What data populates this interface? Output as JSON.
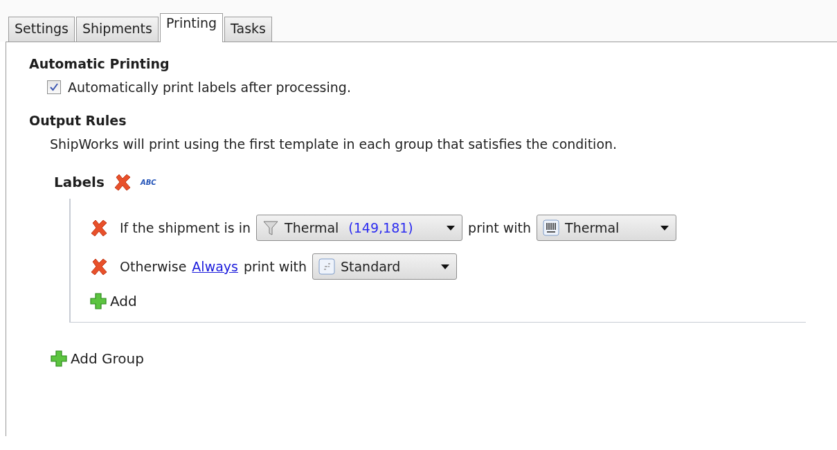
{
  "tabs": [
    {
      "label": "Settings",
      "selected": false
    },
    {
      "label": "Shipments",
      "selected": false
    },
    {
      "label": "Printing",
      "selected": true
    },
    {
      "label": "Tasks",
      "selected": false
    }
  ],
  "automatic_printing": {
    "heading": "Automatic Printing",
    "checkbox": {
      "label": "Automatically print labels after processing.",
      "checked": true
    }
  },
  "output_rules": {
    "heading": "Output Rules",
    "description": "ShipWorks will print using the first template in each group that satisfies the condition.",
    "groups": [
      {
        "name": "Labels",
        "rename_badge": "ABC",
        "rules": [
          {
            "kind": "condition",
            "prefix": "If the shipment is in",
            "filter": {
              "name": "Thermal",
              "count": "(149,181)"
            },
            "middle": "print with",
            "template": {
              "kind": "thermal",
              "name": "Thermal"
            }
          },
          {
            "kind": "otherwise",
            "prefix": "Otherwise",
            "link": "Always",
            "middle": "print with",
            "template": {
              "kind": "standard",
              "name": "Standard"
            }
          }
        ],
        "add_label": "Add"
      }
    ],
    "add_group_label": "Add Group"
  }
}
